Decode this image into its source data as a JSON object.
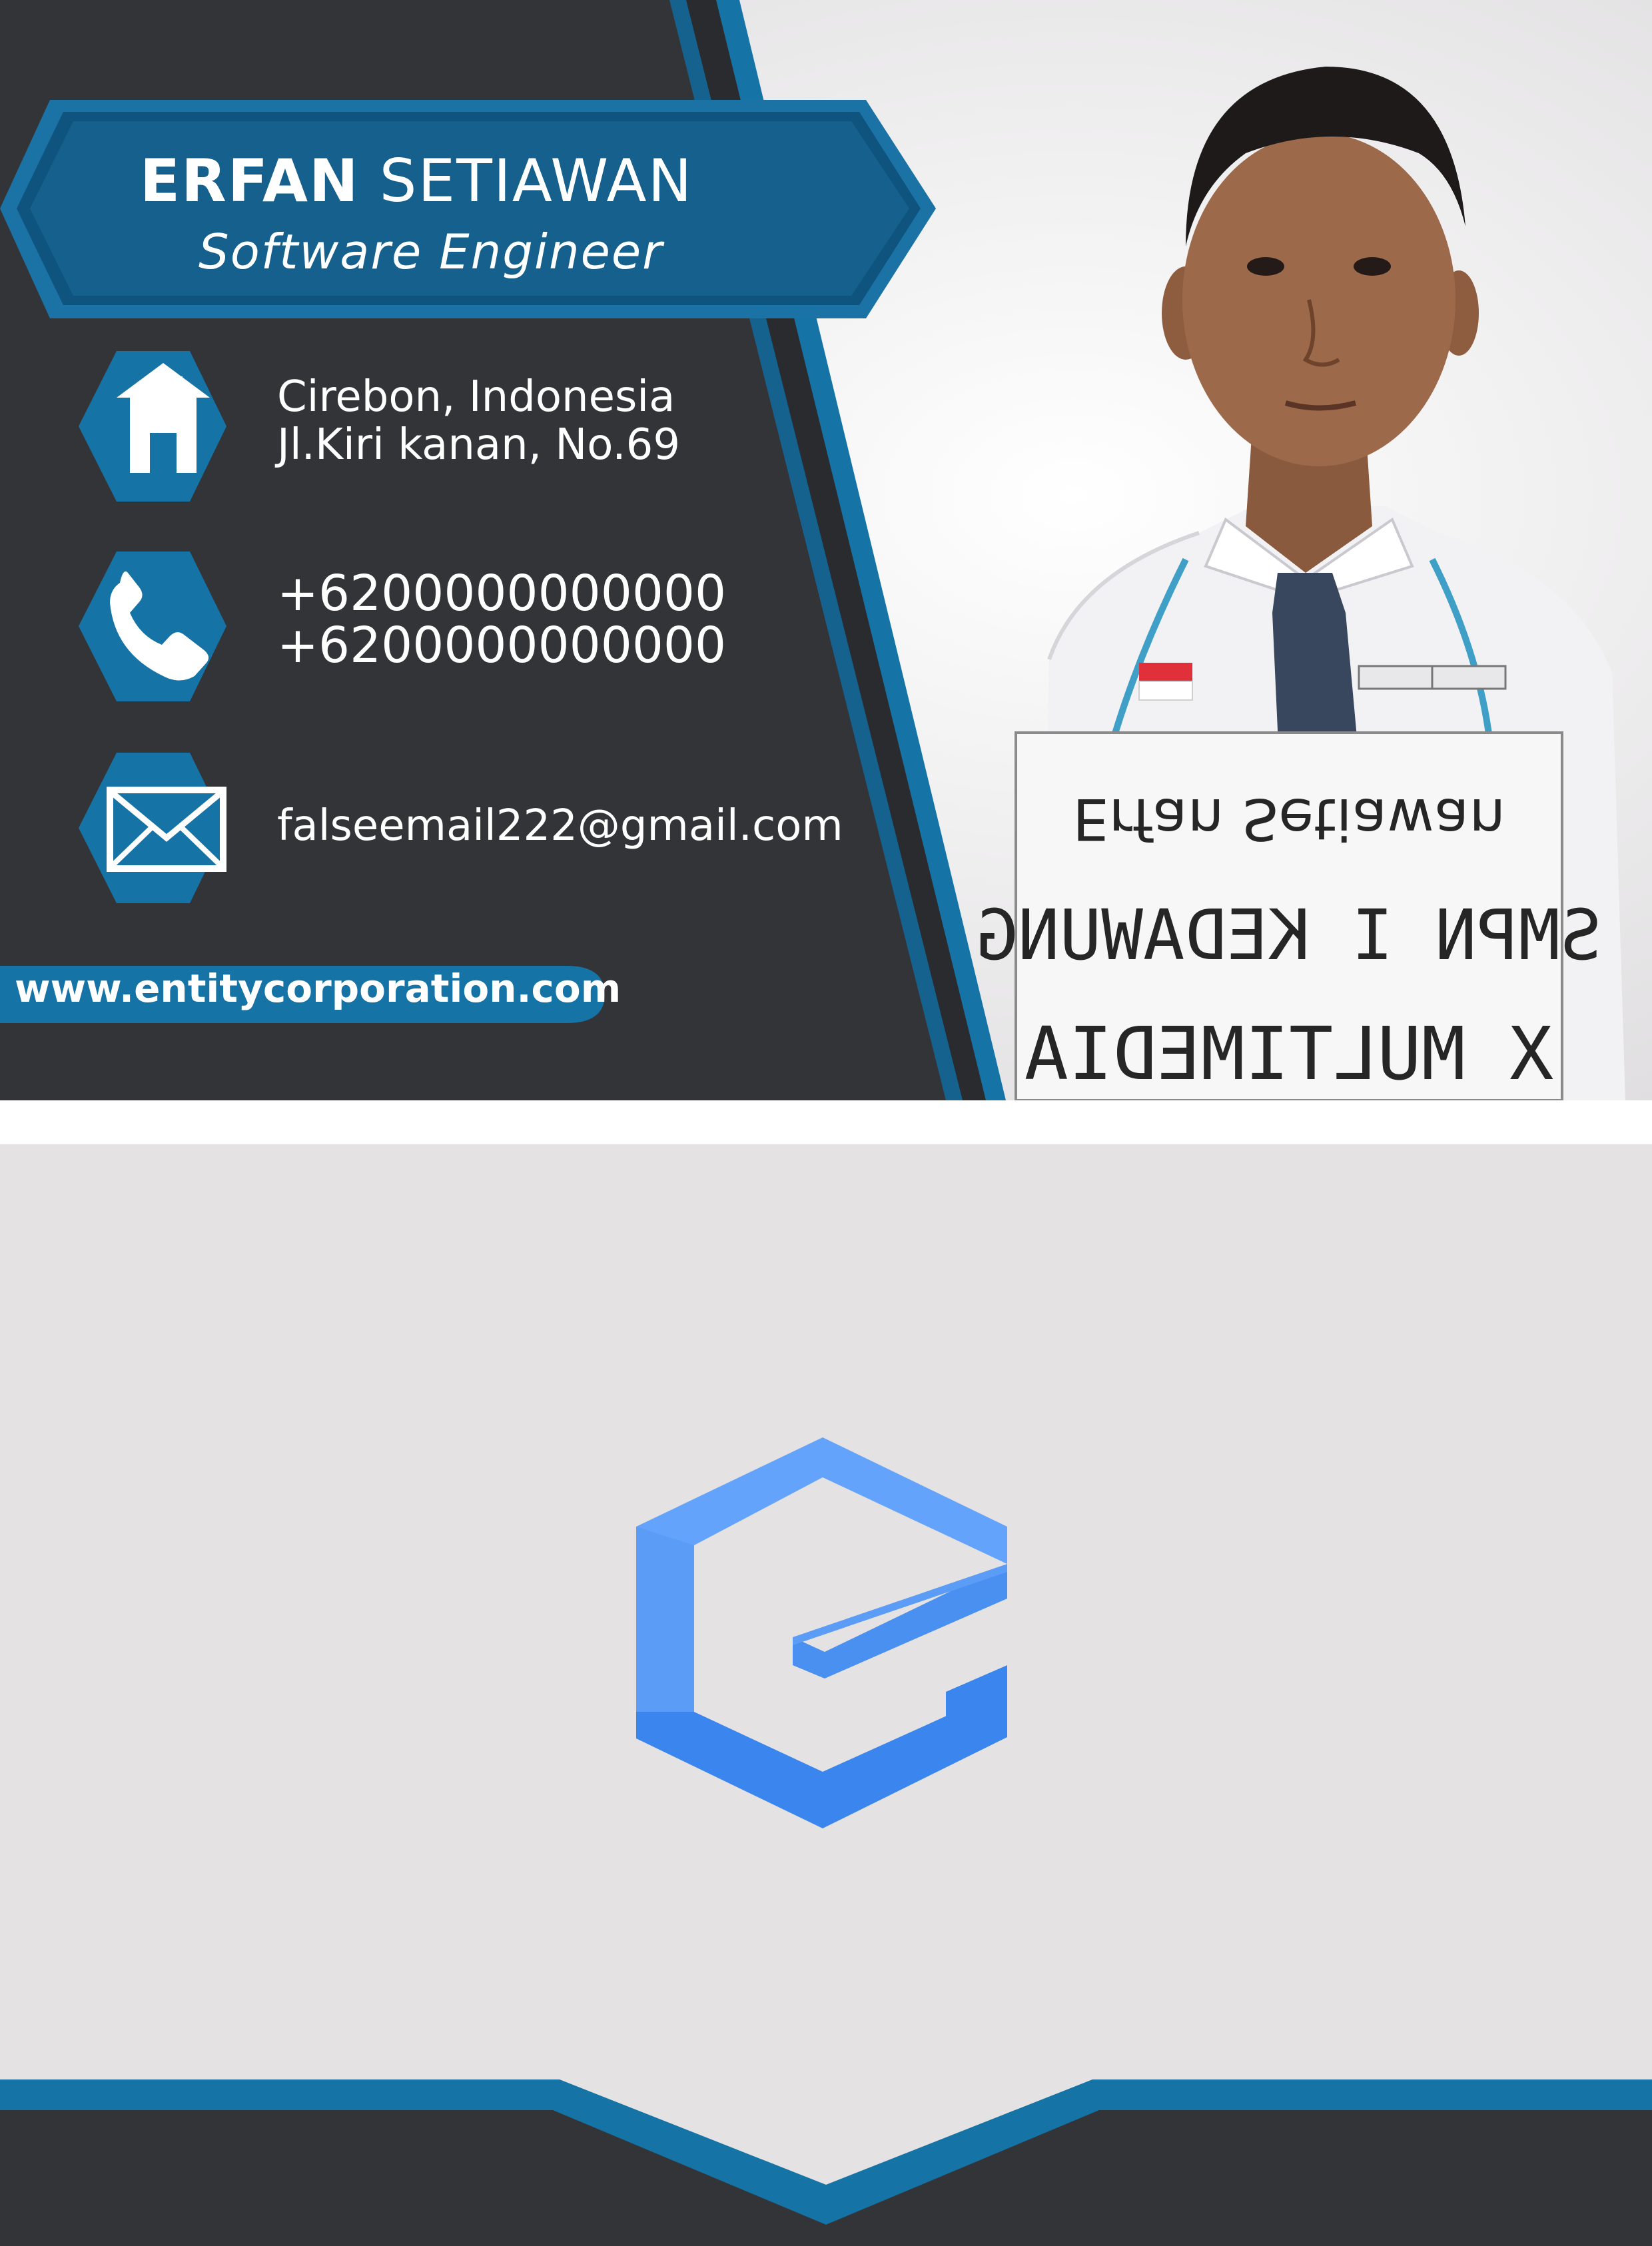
{
  "card": {
    "name_first": "ERFAN",
    "name_last": "SETIAWAN",
    "job_title": "Software Engineer",
    "address_line1": "Cirebon, Indonesia",
    "address_line2": "Jl.Kiri kanan, No.69",
    "phone_1": "+6200000000000",
    "phone_2": "+6200000000000",
    "email": "falseemail222@gmail.com",
    "website": "www.entitycorporation.com"
  },
  "photo_sign": {
    "line1": "Erfan Setiawan",
    "line2": "SMPN I KEDAWUNG",
    "line3": "X MULTIMEDIA"
  },
  "icons": [
    "home-icon",
    "phone-icon",
    "envelope-icon",
    "entity-logo-icon"
  ],
  "colors": {
    "dark_panel": "#333438",
    "accent_blue": "#1673a6",
    "ribbon_blue": "#15608c",
    "light_bg": "#e4e2e3",
    "logo_blue_light": "#64a3fb",
    "logo_blue_dark": "#3b86ee"
  }
}
